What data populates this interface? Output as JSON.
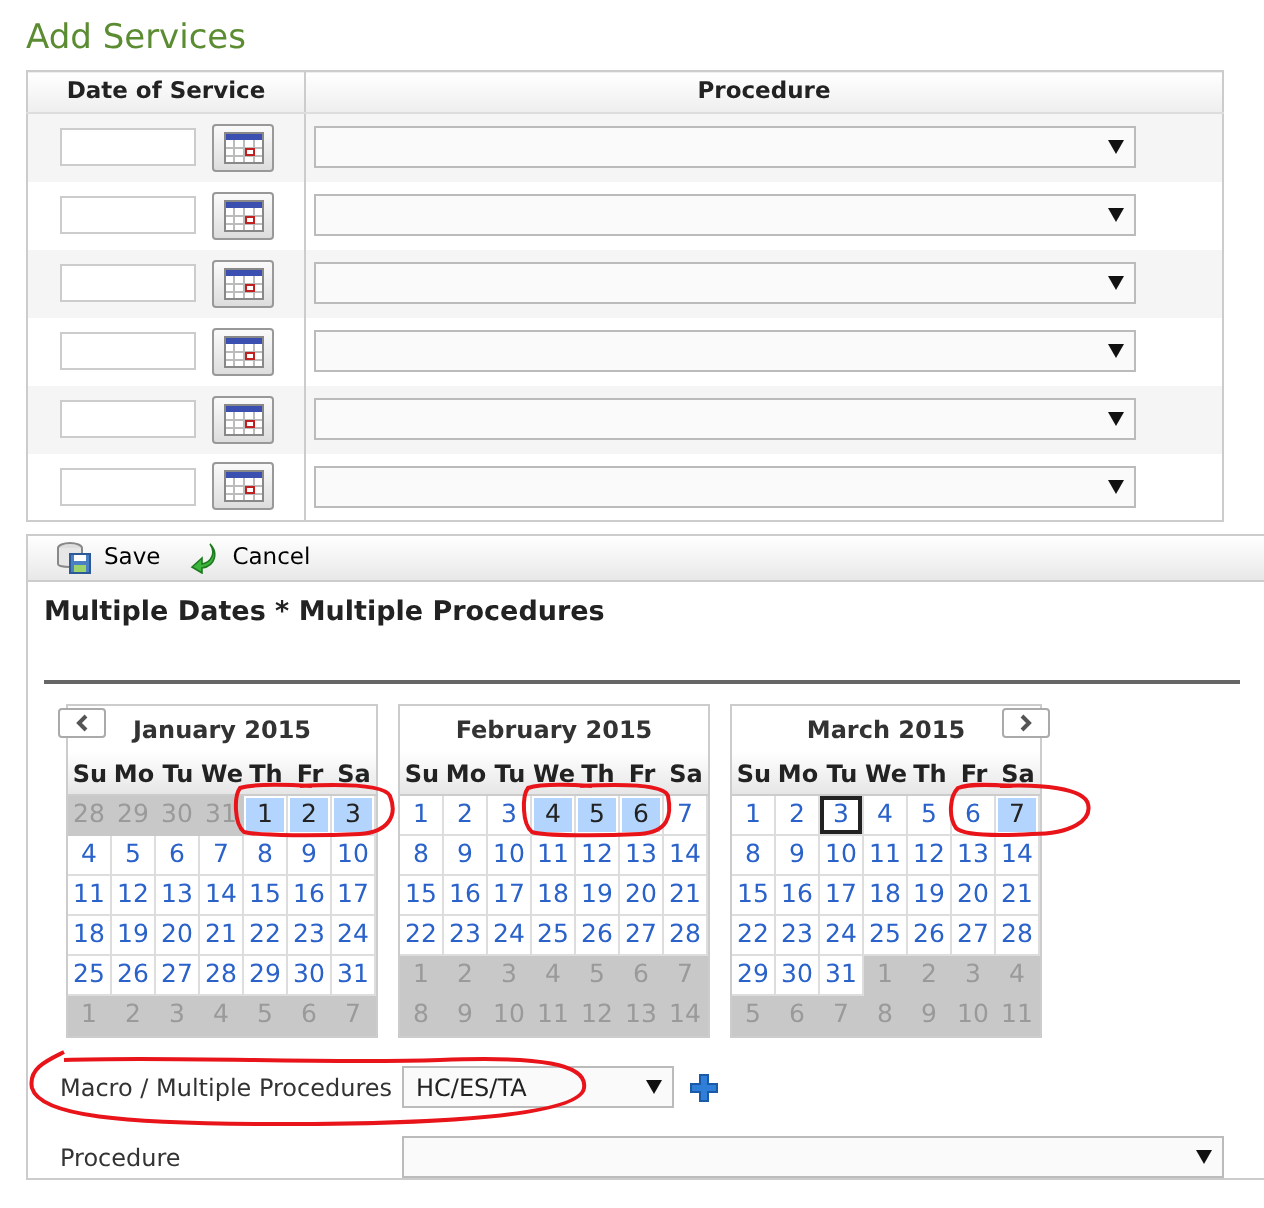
{
  "heading": "Add Services",
  "table": {
    "columns": [
      "Date of Service",
      "Procedure"
    ],
    "rows": [
      {
        "kind": "entry"
      },
      {
        "kind": "entry"
      },
      {
        "kind": "entry"
      },
      {
        "kind": "entry"
      },
      {
        "kind": "entry"
      },
      {
        "kind": "entry"
      }
    ]
  },
  "toolbar": [
    {
      "label": "Save",
      "kind": "save"
    },
    {
      "label": "Cancel",
      "kind": "cancel"
    }
  ],
  "panel_title": "Multiple Dates * Multiple Procedures",
  "calendars": [
    {
      "title": "January 2015",
      "prev_button": true,
      "weekdays": [
        "Su",
        "Mo",
        "Tu",
        "We",
        "Th",
        "Fr",
        "Sa"
      ],
      "weeks": [
        [
          {
            "text": "28",
            "muted": true,
            "selected": false,
            "today": false
          },
          {
            "text": "29",
            "muted": true,
            "selected": false,
            "today": false
          },
          {
            "text": "30",
            "muted": true,
            "selected": false,
            "today": false
          },
          {
            "text": "31",
            "muted": true,
            "selected": false,
            "today": false
          },
          {
            "text": "1",
            "muted": false,
            "selected": true,
            "today": false
          },
          {
            "text": "2",
            "muted": false,
            "selected": true,
            "today": false
          },
          {
            "text": "3",
            "muted": false,
            "selected": true,
            "today": false
          }
        ],
        [
          {
            "text": "4",
            "muted": false,
            "selected": false,
            "today": false
          },
          {
            "text": "5",
            "muted": false,
            "selected": false,
            "today": false
          },
          {
            "text": "6",
            "muted": false,
            "selected": false,
            "today": false
          },
          {
            "text": "7",
            "muted": false,
            "selected": false,
            "today": false
          },
          {
            "text": "8",
            "muted": false,
            "selected": false,
            "today": false
          },
          {
            "text": "9",
            "muted": false,
            "selected": false,
            "today": false
          },
          {
            "text": "10",
            "muted": false,
            "selected": false,
            "today": false
          }
        ],
        [
          {
            "text": "11",
            "muted": false,
            "selected": false,
            "today": false
          },
          {
            "text": "12",
            "muted": false,
            "selected": false,
            "today": false
          },
          {
            "text": "13",
            "muted": false,
            "selected": false,
            "today": false
          },
          {
            "text": "14",
            "muted": false,
            "selected": false,
            "today": false
          },
          {
            "text": "15",
            "muted": false,
            "selected": false,
            "today": false
          },
          {
            "text": "16",
            "muted": false,
            "selected": false,
            "today": false
          },
          {
            "text": "17",
            "muted": false,
            "selected": false,
            "today": false
          }
        ],
        [
          {
            "text": "18",
            "muted": false,
            "selected": false,
            "today": false
          },
          {
            "text": "19",
            "muted": false,
            "selected": false,
            "today": false
          },
          {
            "text": "20",
            "muted": false,
            "selected": false,
            "today": false
          },
          {
            "text": "21",
            "muted": false,
            "selected": false,
            "today": false
          },
          {
            "text": "22",
            "muted": false,
            "selected": false,
            "today": false
          },
          {
            "text": "23",
            "muted": false,
            "selected": false,
            "today": false
          },
          {
            "text": "24",
            "muted": false,
            "selected": false,
            "today": false
          }
        ],
        [
          {
            "text": "25",
            "muted": false,
            "selected": false,
            "today": false
          },
          {
            "text": "26",
            "muted": false,
            "selected": false,
            "today": false
          },
          {
            "text": "27",
            "muted": false,
            "selected": false,
            "today": false
          },
          {
            "text": "28",
            "muted": false,
            "selected": false,
            "today": false
          },
          {
            "text": "29",
            "muted": false,
            "selected": false,
            "today": false
          },
          {
            "text": "30",
            "muted": false,
            "selected": false,
            "today": false
          },
          {
            "text": "31",
            "muted": false,
            "selected": false,
            "today": false
          }
        ],
        [
          {
            "text": "1",
            "muted": true,
            "selected": false,
            "today": false
          },
          {
            "text": "2",
            "muted": true,
            "selected": false,
            "today": false
          },
          {
            "text": "3",
            "muted": true,
            "selected": false,
            "today": false
          },
          {
            "text": "4",
            "muted": true,
            "selected": false,
            "today": false
          },
          {
            "text": "5",
            "muted": true,
            "selected": false,
            "today": false
          },
          {
            "text": "6",
            "muted": true,
            "selected": false,
            "today": false
          },
          {
            "text": "7",
            "muted": true,
            "selected": false,
            "today": false
          }
        ]
      ]
    },
    {
      "title": "February 2015",
      "weekdays": [
        "Su",
        "Mo",
        "Tu",
        "We",
        "Th",
        "Fr",
        "Sa"
      ],
      "weeks": [
        [
          {
            "text": "1",
            "muted": false,
            "selected": false,
            "today": false
          },
          {
            "text": "2",
            "muted": false,
            "selected": false,
            "today": false
          },
          {
            "text": "3",
            "muted": false,
            "selected": false,
            "today": false
          },
          {
            "text": "4",
            "muted": false,
            "selected": true,
            "today": false
          },
          {
            "text": "5",
            "muted": false,
            "selected": true,
            "today": false
          },
          {
            "text": "6",
            "muted": false,
            "selected": true,
            "today": false
          },
          {
            "text": "7",
            "muted": false,
            "selected": false,
            "today": false
          }
        ],
        [
          {
            "text": "8",
            "muted": false,
            "selected": false,
            "today": false
          },
          {
            "text": "9",
            "muted": false,
            "selected": false,
            "today": false
          },
          {
            "text": "10",
            "muted": false,
            "selected": false,
            "today": false
          },
          {
            "text": "11",
            "muted": false,
            "selected": false,
            "today": false
          },
          {
            "text": "12",
            "muted": false,
            "selected": false,
            "today": false
          },
          {
            "text": "13",
            "muted": false,
            "selected": false,
            "today": false
          },
          {
            "text": "14",
            "muted": false,
            "selected": false,
            "today": false
          }
        ],
        [
          {
            "text": "15",
            "muted": false,
            "selected": false,
            "today": false
          },
          {
            "text": "16",
            "muted": false,
            "selected": false,
            "today": false
          },
          {
            "text": "17",
            "muted": false,
            "selected": false,
            "today": false
          },
          {
            "text": "18",
            "muted": false,
            "selected": false,
            "today": false
          },
          {
            "text": "19",
            "muted": false,
            "selected": false,
            "today": false
          },
          {
            "text": "20",
            "muted": false,
            "selected": false,
            "today": false
          },
          {
            "text": "21",
            "muted": false,
            "selected": false,
            "today": false
          }
        ],
        [
          {
            "text": "22",
            "muted": false,
            "selected": false,
            "today": false
          },
          {
            "text": "23",
            "muted": false,
            "selected": false,
            "today": false
          },
          {
            "text": "24",
            "muted": false,
            "selected": false,
            "today": false
          },
          {
            "text": "25",
            "muted": false,
            "selected": false,
            "today": false
          },
          {
            "text": "26",
            "muted": false,
            "selected": false,
            "today": false
          },
          {
            "text": "27",
            "muted": false,
            "selected": false,
            "today": false
          },
          {
            "text": "28",
            "muted": false,
            "selected": false,
            "today": false
          }
        ],
        [
          {
            "text": "1",
            "muted": true,
            "selected": false,
            "today": false
          },
          {
            "text": "2",
            "muted": true,
            "selected": false,
            "today": false
          },
          {
            "text": "3",
            "muted": true,
            "selected": false,
            "today": false
          },
          {
            "text": "4",
            "muted": true,
            "selected": false,
            "today": false
          },
          {
            "text": "5",
            "muted": true,
            "selected": false,
            "today": false
          },
          {
            "text": "6",
            "muted": true,
            "selected": false,
            "today": false
          },
          {
            "text": "7",
            "muted": true,
            "selected": false,
            "today": false
          }
        ],
        [
          {
            "text": "8",
            "muted": true,
            "selected": false,
            "today": false
          },
          {
            "text": "9",
            "muted": true,
            "selected": false,
            "today": false
          },
          {
            "text": "10",
            "muted": true,
            "selected": false,
            "today": false
          },
          {
            "text": "11",
            "muted": true,
            "selected": false,
            "today": false
          },
          {
            "text": "12",
            "muted": true,
            "selected": false,
            "today": false
          },
          {
            "text": "13",
            "muted": true,
            "selected": false,
            "today": false
          },
          {
            "text": "14",
            "muted": true,
            "selected": false,
            "today": false
          }
        ]
      ]
    },
    {
      "title": "March 2015",
      "next_button": true,
      "weekdays": [
        "Su",
        "Mo",
        "Tu",
        "We",
        "Th",
        "Fr",
        "Sa"
      ],
      "weeks": [
        [
          {
            "text": "1",
            "muted": false,
            "selected": false,
            "today": false
          },
          {
            "text": "2",
            "muted": false,
            "selected": false,
            "today": false
          },
          {
            "text": "3",
            "muted": false,
            "selected": false,
            "today": true
          },
          {
            "text": "4",
            "muted": false,
            "selected": false,
            "today": false
          },
          {
            "text": "5",
            "muted": false,
            "selected": false,
            "today": false
          },
          {
            "text": "6",
            "muted": false,
            "selected": false,
            "today": false
          },
          {
            "text": "7",
            "muted": false,
            "selected": true,
            "today": false
          }
        ],
        [
          {
            "text": "8",
            "muted": false,
            "selected": false,
            "today": false
          },
          {
            "text": "9",
            "muted": false,
            "selected": false,
            "today": false
          },
          {
            "text": "10",
            "muted": false,
            "selected": false,
            "today": false
          },
          {
            "text": "11",
            "muted": false,
            "selected": false,
            "today": false
          },
          {
            "text": "12",
            "muted": false,
            "selected": false,
            "today": false
          },
          {
            "text": "13",
            "muted": false,
            "selected": false,
            "today": false
          },
          {
            "text": "14",
            "muted": false,
            "selected": false,
            "today": false
          }
        ],
        [
          {
            "text": "15",
            "muted": false,
            "selected": false,
            "today": false
          },
          {
            "text": "16",
            "muted": false,
            "selected": false,
            "today": false
          },
          {
            "text": "17",
            "muted": false,
            "selected": false,
            "today": false
          },
          {
            "text": "18",
            "muted": false,
            "selected": false,
            "today": false
          },
          {
            "text": "19",
            "muted": false,
            "selected": false,
            "today": false
          },
          {
            "text": "20",
            "muted": false,
            "selected": false,
            "today": false
          },
          {
            "text": "21",
            "muted": false,
            "selected": false,
            "today": false
          }
        ],
        [
          {
            "text": "22",
            "muted": false,
            "selected": false,
            "today": false
          },
          {
            "text": "23",
            "muted": false,
            "selected": false,
            "today": false
          },
          {
            "text": "24",
            "muted": false,
            "selected": false,
            "today": false
          },
          {
            "text": "25",
            "muted": false,
            "selected": false,
            "today": false
          },
          {
            "text": "26",
            "muted": false,
            "selected": false,
            "today": false
          },
          {
            "text": "27",
            "muted": false,
            "selected": false,
            "today": false
          },
          {
            "text": "28",
            "muted": false,
            "selected": false,
            "today": false
          }
        ],
        [
          {
            "text": "29",
            "muted": false,
            "selected": false,
            "today": false
          },
          {
            "text": "30",
            "muted": false,
            "selected": false,
            "today": false
          },
          {
            "text": "31",
            "muted": false,
            "selected": false,
            "today": false
          },
          {
            "text": "1",
            "muted": true,
            "selected": false,
            "today": false
          },
          {
            "text": "2",
            "muted": true,
            "selected": false,
            "today": false
          },
          {
            "text": "3",
            "muted": true,
            "selected": false,
            "today": false
          },
          {
            "text": "4",
            "muted": true,
            "selected": false,
            "today": false
          }
        ],
        [
          {
            "text": "5",
            "muted": true,
            "selected": false,
            "today": false
          },
          {
            "text": "6",
            "muted": true,
            "selected": false,
            "today": false
          },
          {
            "text": "7",
            "muted": true,
            "selected": false,
            "today": false
          },
          {
            "text": "8",
            "muted": true,
            "selected": false,
            "today": false
          },
          {
            "text": "9",
            "muted": true,
            "selected": false,
            "today": false
          },
          {
            "text": "10",
            "muted": true,
            "selected": false,
            "today": false
          },
          {
            "text": "11",
            "muted": true,
            "selected": false,
            "today": false
          }
        ]
      ]
    }
  ],
  "form": [
    {
      "label": "Macro / Multiple Procedures",
      "value": "HC/ES/TA",
      "kind": "macro"
    },
    {
      "label": "Procedure",
      "kind": "procedure"
    }
  ]
}
